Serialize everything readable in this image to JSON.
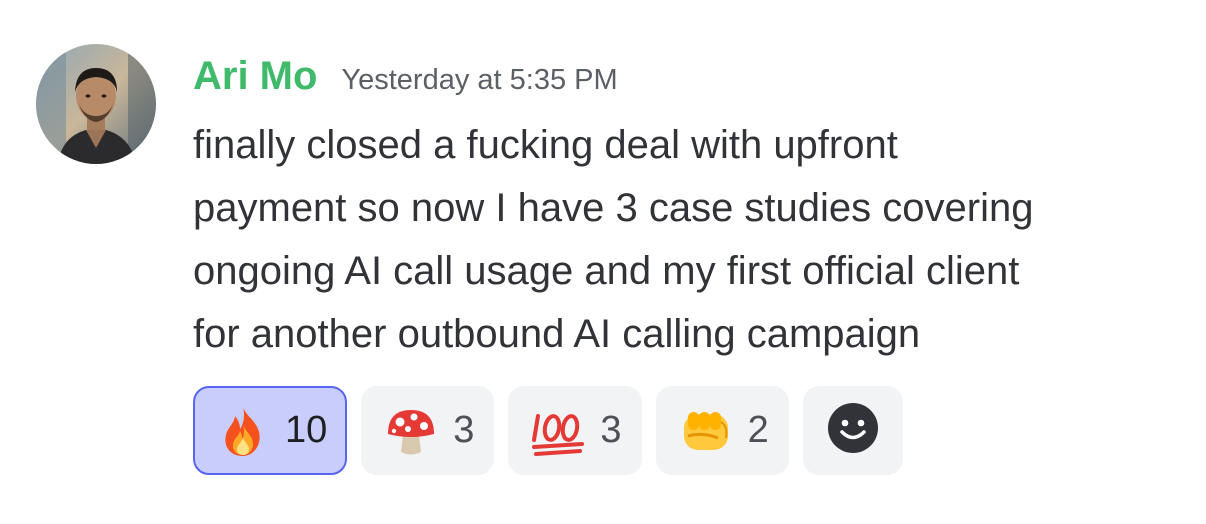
{
  "message": {
    "author": "Ari Mo",
    "author_color": "#3fba6b",
    "timestamp": "Yesterday at 5:35 PM",
    "lines": [
      "finally closed a fucking deal with upfront",
      "payment so now I have 3 case studies covering",
      "ongoing AI call usage and my first official client",
      "for another outbound AI calling campaign"
    ]
  },
  "reactions": [
    {
      "emoji": "fire-emoji",
      "count": "10",
      "active": true
    },
    {
      "emoji": "mushroom-emoji",
      "count": "3",
      "active": false
    },
    {
      "emoji": "hundred-points-emoji",
      "count": "3",
      "active": false
    },
    {
      "emoji": "oncoming-fist-emoji",
      "count": "2",
      "active": false
    }
  ],
  "add_reaction": {
    "icon": "smiley-add-icon"
  },
  "colors": {
    "active_reaction_bg": "#c9cdfb",
    "active_reaction_border": "#5865f2",
    "reaction_bg": "#f2f3f5"
  }
}
